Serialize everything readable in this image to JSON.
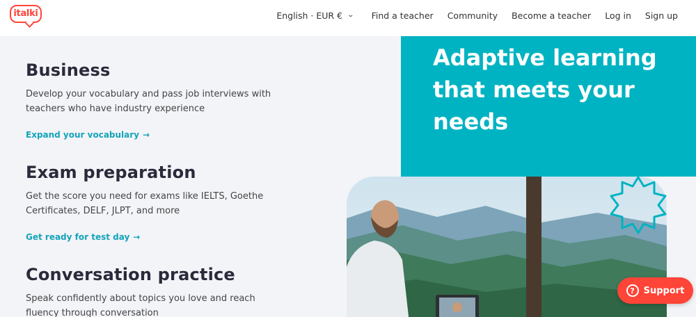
{
  "brand": {
    "logo_text": "italki",
    "accent": "#ff4438",
    "teal": "#00b3c2",
    "link": "#15a3b8"
  },
  "nav": {
    "language": "English · EUR €",
    "items": [
      "Find a teacher",
      "Community",
      "Become a teacher",
      "Log in",
      "Sign up"
    ]
  },
  "features": [
    {
      "title": "Business",
      "description": "Develop your vocabulary and pass job interviews with teachers who have industry experience",
      "link": "Expand your vocabulary",
      "arrow": "→"
    },
    {
      "title": "Exam preparation",
      "description": "Get the score you need for exams like IELTS, Goethe Certificates, DELF, JLPT, and more",
      "link": "Get ready for test day",
      "arrow": "→"
    },
    {
      "title": "Conversation practice",
      "description": "Speak confidently about topics you love and reach fluency through conversation"
    }
  ],
  "hero": {
    "headline": "Adaptive learning that meets your needs"
  },
  "support": {
    "label": "Support",
    "icon": "?"
  },
  "icons": [
    "chevron-down-icon",
    "arrow-right-icon",
    "question-icon",
    "sun-icon"
  ]
}
